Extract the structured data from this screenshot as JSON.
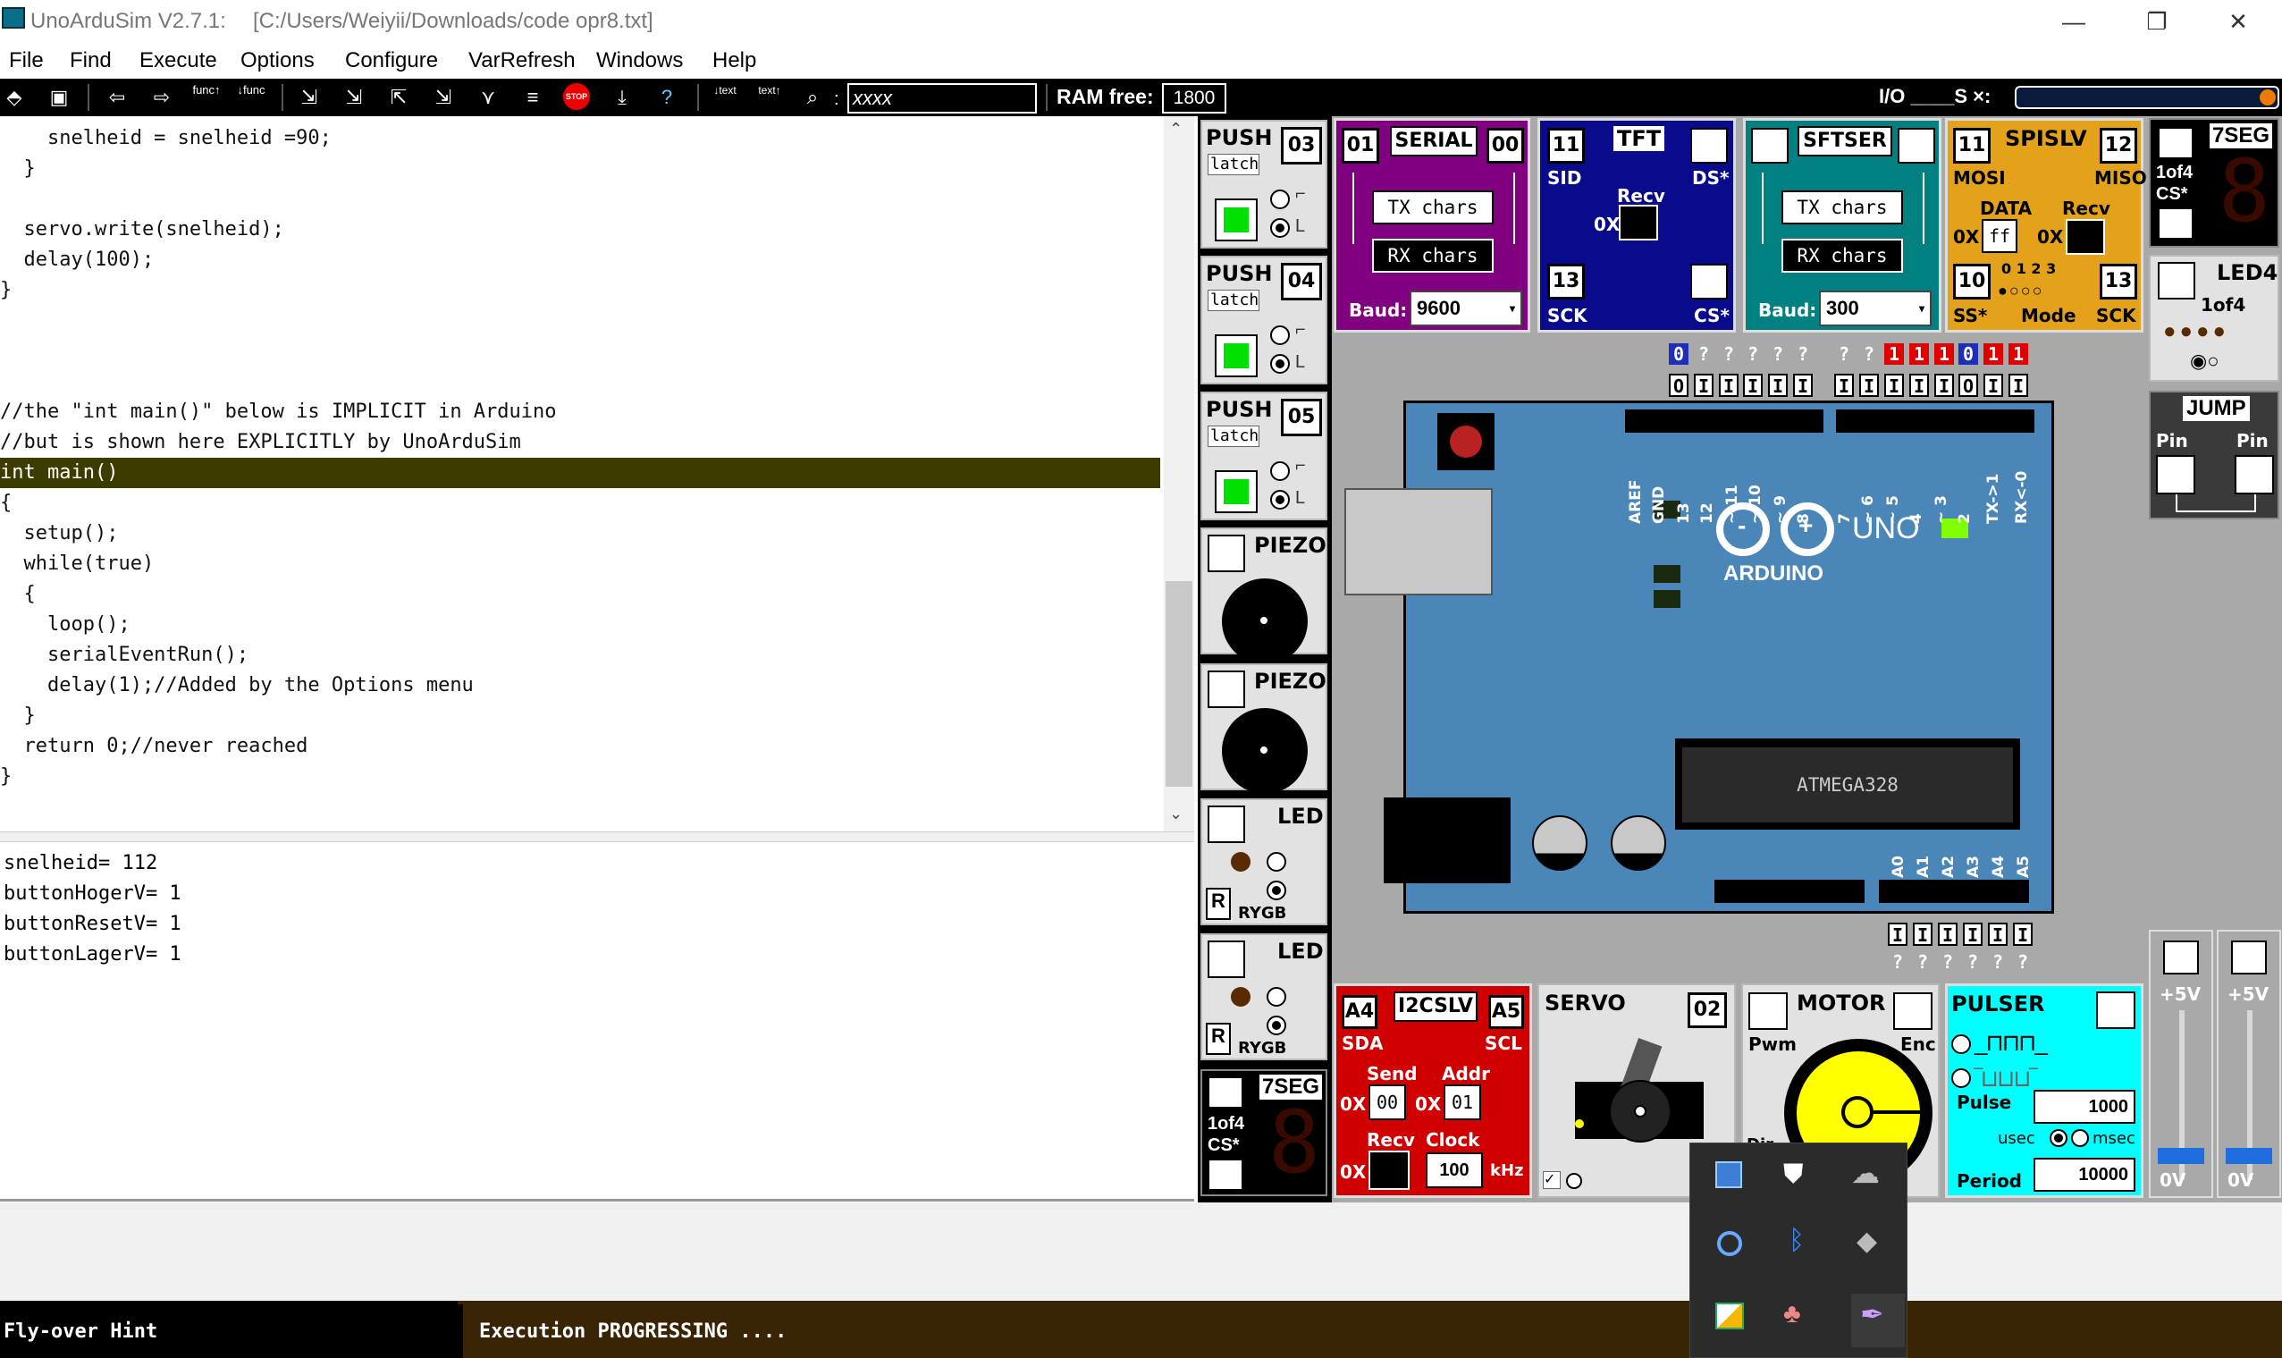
{
  "window": {
    "app_title": "UnoArduSim V2.7.1:",
    "file_path": "[C:/Users/Weiyii/Downloads/code opr8.txt]",
    "minimize": "—",
    "restore": "❐",
    "close": "✕"
  },
  "menu": [
    "File",
    "Find",
    "Execute",
    "Options",
    "Configure",
    "VarRefresh",
    "Windows",
    "Help"
  ],
  "toolbar": {
    "search_value": "xxxx",
    "ram_label": "RAM free:",
    "ram_value": "1800",
    "io_label": "I/O ____S ×:",
    "func_label": "func",
    "text_label": "text",
    "stop_label": "STOP"
  },
  "code_lines": [
    "    snelheid = snelheid =90;",
    "  }",
    "",
    "  servo.write(snelheid);",
    "  delay(100);",
    "}",
    "",
    "",
    "",
    "//the \"int main()\" below is IMPLICIT in Arduino",
    "//but is shown here EXPLICITLY by UnoArduSim",
    "int main()",
    "{",
    "  setup();",
    "  while(true)",
    "  {",
    "    loop();",
    "    serialEventRun();",
    "    delay(1);//Added by the Options menu",
    "  }",
    "  return 0;//never reached",
    "}"
  ],
  "highlight_line": 11,
  "variables": [
    "snelheid= 112",
    "buttonHogerV= 1",
    "buttonResetV= 1",
    "buttonLagerV= 1"
  ],
  "status": {
    "hint": "Fly-over Hint",
    "message": "Execution PROGRESSING ...."
  },
  "devices": {
    "push": [
      {
        "label": "PUSH",
        "pin": "03",
        "latch": "latch"
      },
      {
        "label": "PUSH",
        "pin": "04",
        "latch": "latch"
      },
      {
        "label": "PUSH",
        "pin": "05",
        "latch": "latch"
      }
    ],
    "piezo": [
      "PIEZO",
      "PIEZO"
    ],
    "led": [
      {
        "label": "LED",
        "r": "R",
        "rygb": "RYGB"
      },
      {
        "label": "LED",
        "r": "R",
        "rygb": "RYGB"
      }
    ],
    "sevenseg_left": {
      "label": "7SEG",
      "of": "1of4",
      "cs": "CS*",
      "digit": "8"
    },
    "serial": {
      "label": "SERIAL",
      "pin_tx": "01",
      "pin_rx": "00",
      "tx": "TX chars",
      "rx": "RX chars",
      "baud_label": "Baud:",
      "baud": "9600"
    },
    "tft": {
      "label": "TFT",
      "pin1": "11",
      "sid": "SID",
      "ds": "DS*",
      "recv": "Recv",
      "ox": "0X",
      "pin2": "13",
      "sck": "SCK",
      "cs": "CS*"
    },
    "sftser": {
      "label": "SFTSER",
      "tx": "TX chars",
      "rx": "RX chars",
      "baud_label": "Baud:",
      "baud": "300"
    },
    "spislv": {
      "label": "SPISLV",
      "pin_mosi": "11",
      "pin_miso": "12",
      "mosi": "MOSI",
      "miso": "MISO",
      "data": "DATA",
      "recv": "Recv",
      "ox1": "0X",
      "ox2": "0X",
      "data_val": "ff",
      "pin_ss": "10",
      "pin_sck": "13",
      "ss": "SS*",
      "sck": "SCK",
      "mode": "Mode",
      "modes": "0 1 2 3"
    },
    "sevenseg_right": {
      "label": "7SEG",
      "of": "1of4",
      "cs": "CS*",
      "digit": "8"
    },
    "led4": {
      "label": "LED4",
      "of": "1of4"
    },
    "jump": {
      "label": "JUMP",
      "pin1": "Pin",
      "pin2": "Pin"
    },
    "i2cslv": {
      "label": "I2CSLV",
      "pin_sda": "A4",
      "pin_scl": "A5",
      "sda": "SDA",
      "scl": "SCL",
      "send": "Send",
      "addr": "Addr",
      "ox": "0X",
      "send_val": "00",
      "addr_val": "01",
      "recv": "Recv",
      "clock": "Clock",
      "clock_val": "100",
      "khz": "kHz"
    },
    "servo": {
      "label": "SERVO",
      "pin": "02"
    },
    "motor": {
      "label": "MOTOR",
      "pwm": "Pwm",
      "enc": "Enc",
      "dir": "Dir"
    },
    "pulser": {
      "label": "PULSER",
      "pulse": "Pulse",
      "pulse_val": "1000",
      "usec": "usec",
      "msec": "msec",
      "period": "Period",
      "period_val": "10000"
    },
    "pots": [
      {
        "top": "+5V",
        "bottom": "0V"
      },
      {
        "top": "+5V",
        "bottom": "0V"
      }
    ]
  },
  "board": {
    "top_pin_states": [
      "0",
      "?",
      "?",
      "?",
      "?",
      "?",
      "",
      "?",
      "?",
      "1",
      "1",
      "1",
      "0",
      "1",
      "1"
    ],
    "top_pin_types": [
      "O",
      "I",
      "I",
      "I",
      "I",
      "I",
      "",
      "I",
      "I",
      "I",
      "I",
      "I",
      "O",
      "I",
      "I"
    ],
    "top_labels": [
      "AREF",
      "GND",
      "13",
      "12",
      "~ 11",
      "~ 10",
      "~ 9",
      "8",
      "",
      "7",
      "~ 6",
      "~ 5",
      "4",
      "~ 3",
      "2",
      "TX->1",
      "RX<-0"
    ],
    "bottom_labels": [
      "A0",
      "A1",
      "A2",
      "A3",
      "A4",
      "A5"
    ],
    "bottom_types": [
      "I",
      "I",
      "I",
      "I",
      "I",
      "I"
    ],
    "bottom_states": [
      "?",
      "?",
      "?",
      "?",
      "?",
      "?"
    ],
    "uno": "UNO",
    "arduino": "ARDUINO",
    "chip": "ATMEGA328",
    "minus": "-",
    "plus": "+"
  },
  "colors": {
    "serial": "#800080",
    "tft": "#0a0a8c",
    "sftser": "#008080",
    "spislv": "#e3a21a",
    "i2cslv": "#d00000",
    "pulser": "#00ffff",
    "board": "#4a86b8",
    "highlight": "#3c3c00",
    "status": "#3a2406"
  }
}
